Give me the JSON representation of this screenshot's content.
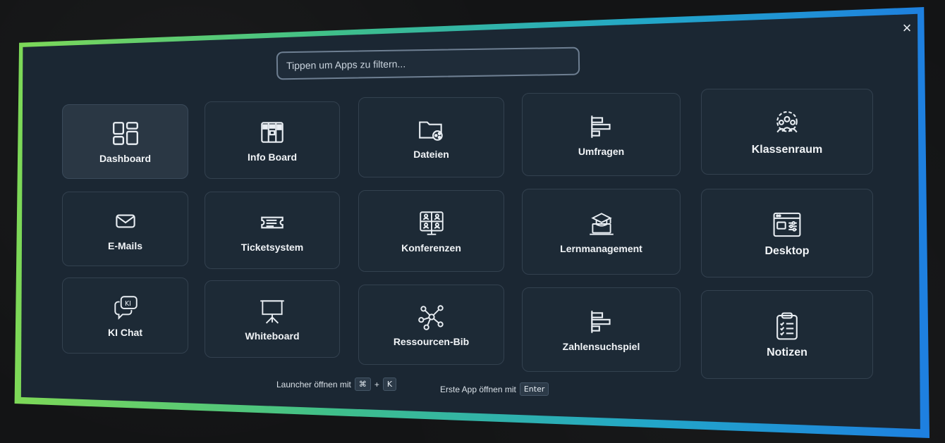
{
  "search": {
    "placeholder": "Tippen um Apps zu filtern..."
  },
  "close": {
    "glyph": "×"
  },
  "apps": [
    {
      "label": "Dashboard",
      "icon": "dashboard-grid-icon"
    },
    {
      "label": "Info Board",
      "icon": "info-board-icon"
    },
    {
      "label": "Dateien",
      "icon": "folder-share-icon"
    },
    {
      "label": "Umfragen",
      "icon": "bar-chart-icon"
    },
    {
      "label": "Klassenraum",
      "icon": "classroom-gear-icon"
    },
    {
      "label": "E-Mails",
      "icon": "mail-icon"
    },
    {
      "label": "Ticketsystem",
      "icon": "ticket-icon"
    },
    {
      "label": "Konferenzen",
      "icon": "video-conference-icon"
    },
    {
      "label": "Lernmanagement",
      "icon": "graduation-laptop-icon"
    },
    {
      "label": "Desktop",
      "icon": "desktop-window-icon"
    },
    {
      "label": "KI Chat",
      "icon": "ai-chat-icon"
    },
    {
      "label": "Whiteboard",
      "icon": "whiteboard-icon"
    },
    {
      "label": "Ressourcen-Bib",
      "icon": "network-icon"
    },
    {
      "label": "Zahlensuchspiel",
      "icon": "bar-chart-icon"
    },
    {
      "label": "Notizen",
      "icon": "clipboard-icon"
    }
  ],
  "hints": {
    "launcher_text": "Launcher öffnen mit",
    "launcher_key1": "⌘",
    "plus": "+",
    "launcher_key2": "K",
    "first_app_text": "Erste App öffnen mit",
    "first_app_key": "Enter"
  },
  "colors": {
    "panel": "#1b2733",
    "border_start": "#7ed957",
    "border_end": "#1e7fe0"
  }
}
